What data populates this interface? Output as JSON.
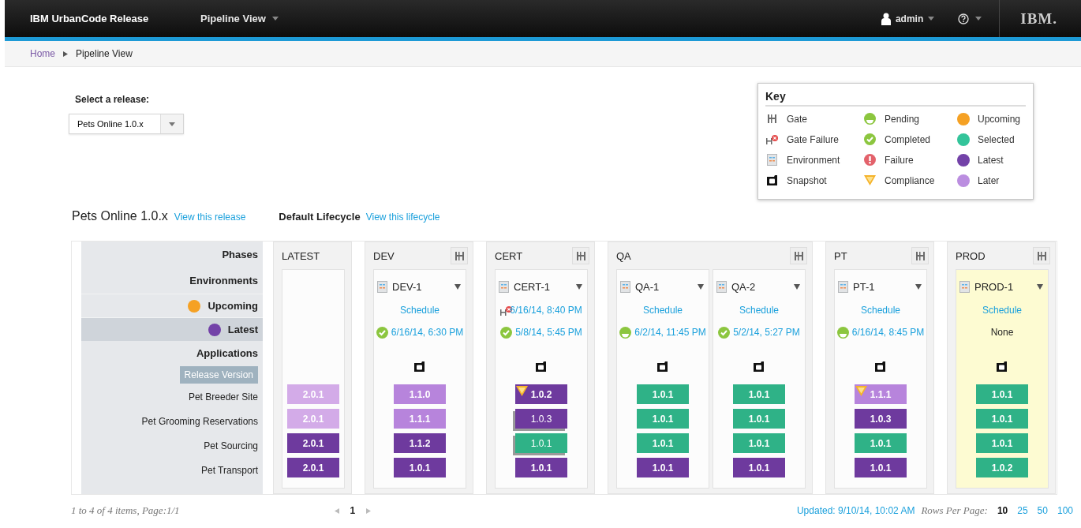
{
  "navbar": {
    "brand": "IBM UrbanCode Release",
    "menu": "Pipeline View",
    "user": "admin",
    "logo": "IBM."
  },
  "breadcrumb": {
    "home": "Home",
    "current": "Pipeline View"
  },
  "release_select": {
    "label": "Select a release:",
    "value": "Pets Online 1.0.x"
  },
  "key": {
    "title": "Key",
    "items": [
      {
        "label": "Gate",
        "kind": "gate"
      },
      {
        "label": "Pending",
        "kind": "pending"
      },
      {
        "label": "Upcoming",
        "kind": "dot",
        "color": "#f5a124"
      },
      {
        "label": "Gate Failure",
        "kind": "gate_failure"
      },
      {
        "label": "Completed",
        "kind": "completed"
      },
      {
        "label": "Selected",
        "kind": "dot",
        "color": "#33c49a"
      },
      {
        "label": "Environment",
        "kind": "environment"
      },
      {
        "label": "Failure",
        "kind": "failure"
      },
      {
        "label": "Latest",
        "kind": "dot",
        "color": "#7342a8"
      },
      {
        "label": "Snapshot",
        "kind": "snapshot"
      },
      {
        "label": "Compliance",
        "kind": "compliance"
      },
      {
        "label": "Later",
        "kind": "dot",
        "color": "#bb8ee0"
      }
    ]
  },
  "heading": {
    "release": "Pets Online 1.0.x",
    "release_link": "View this release",
    "lifecycle": "Default Lifecycle",
    "lifecycle_link": "View this lifecycle"
  },
  "sidebar": {
    "phases": "Phases",
    "environments": "Environments",
    "filters": [
      {
        "label": "Upcoming",
        "color": "#f5a124",
        "selected": false
      },
      {
        "label": "Latest",
        "color": "#7342a8",
        "selected": true
      }
    ],
    "applications": "Applications",
    "release_version": "Release Version",
    "apps": [
      "Pet Breeder Site",
      "Pet Grooming Reservations",
      "Pet Sourcing",
      "Pet Transport"
    ]
  },
  "phases": [
    {
      "name": "LATEST",
      "gate": false,
      "environments": [
        {
          "highlighted": false,
          "versions": [
            {
              "text": "2.0.1",
              "kind": "faded",
              "compliance": false,
              "stacked": false
            },
            {
              "text": "2.0.1",
              "kind": "faded",
              "compliance": false,
              "stacked": false
            },
            {
              "text": "2.0.1",
              "kind": "latest",
              "compliance": false,
              "stacked": false
            },
            {
              "text": "2.0.1",
              "kind": "latest",
              "compliance": false,
              "stacked": false
            }
          ]
        }
      ]
    },
    {
      "name": "DEV",
      "gate": true,
      "environments": [
        {
          "name": "DEV-1",
          "highlighted": false,
          "schedule": {
            "kind": "link",
            "text": "Schedule"
          },
          "last": {
            "kind": "completed",
            "text": "6/16/14, 6:30 PM"
          },
          "versions": [
            {
              "text": "1.1.0",
              "kind": "later",
              "compliance": false,
              "stacked": false
            },
            {
              "text": "1.1.1",
              "kind": "later",
              "compliance": false,
              "stacked": false
            },
            {
              "text": "1.1.2",
              "kind": "latest",
              "compliance": false,
              "stacked": false
            },
            {
              "text": "1.0.1",
              "kind": "latest",
              "compliance": false,
              "stacked": false
            }
          ]
        }
      ]
    },
    {
      "name": "CERT",
      "gate": true,
      "environments": [
        {
          "name": "CERT-1",
          "highlighted": false,
          "schedule": {
            "kind": "gate_failure",
            "text": "6/16/14, 8:40 PM"
          },
          "last": {
            "kind": "completed",
            "text": "5/8/14, 5:45 PM"
          },
          "versions": [
            {
              "text": "1.0.2",
              "kind": "latest",
              "compliance": true,
              "stacked": false
            },
            {
              "text": "1.0.3",
              "kind": "latest",
              "compliance": false,
              "stacked": true
            },
            {
              "text": "1.0.1",
              "kind": "selected",
              "compliance": false,
              "stacked": true
            },
            {
              "text": "1.0.1",
              "kind": "latest",
              "compliance": false,
              "stacked": false
            }
          ]
        }
      ]
    },
    {
      "name": "QA",
      "gate": true,
      "environments": [
        {
          "name": "QA-1",
          "highlighted": false,
          "schedule": {
            "kind": "link",
            "text": "Schedule"
          },
          "last": {
            "kind": "pending",
            "text": "6/2/14, 11:45 PM"
          },
          "versions": [
            {
              "text": "1.0.1",
              "kind": "selected",
              "compliance": false,
              "stacked": false
            },
            {
              "text": "1.0.1",
              "kind": "selected",
              "compliance": false,
              "stacked": false
            },
            {
              "text": "1.0.1",
              "kind": "selected",
              "compliance": false,
              "stacked": false
            },
            {
              "text": "1.0.1",
              "kind": "latest",
              "compliance": false,
              "stacked": false
            }
          ]
        },
        {
          "name": "QA-2",
          "highlighted": false,
          "schedule": {
            "kind": "link",
            "text": "Schedule"
          },
          "last": {
            "kind": "completed",
            "text": "5/2/14, 5:27 PM"
          },
          "versions": [
            {
              "text": "1.0.1",
              "kind": "selected",
              "compliance": false,
              "stacked": false
            },
            {
              "text": "1.0.1",
              "kind": "selected",
              "compliance": false,
              "stacked": false
            },
            {
              "text": "1.0.1",
              "kind": "selected",
              "compliance": false,
              "stacked": false
            },
            {
              "text": "1.0.1",
              "kind": "latest",
              "compliance": false,
              "stacked": false
            }
          ]
        }
      ]
    },
    {
      "name": "PT",
      "gate": true,
      "environments": [
        {
          "name": "PT-1",
          "highlighted": false,
          "schedule": {
            "kind": "link",
            "text": "Schedule"
          },
          "last": {
            "kind": "pending",
            "text": "6/16/14, 8:45 PM"
          },
          "versions": [
            {
              "text": "1.1.1",
              "kind": "later",
              "compliance": true,
              "stacked": false
            },
            {
              "text": "1.0.3",
              "kind": "latest",
              "compliance": false,
              "stacked": false
            },
            {
              "text": "1.0.1",
              "kind": "selected",
              "compliance": false,
              "stacked": false
            },
            {
              "text": "1.0.1",
              "kind": "latest",
              "compliance": false,
              "stacked": false
            }
          ]
        }
      ]
    },
    {
      "name": "PROD",
      "gate": true,
      "environments": [
        {
          "name": "PROD-1",
          "highlighted": true,
          "schedule": {
            "kind": "link",
            "text": "Schedule"
          },
          "last": {
            "kind": "none",
            "text": "None"
          },
          "versions": [
            {
              "text": "1.0.1",
              "kind": "selected",
              "compliance": false,
              "stacked": false
            },
            {
              "text": "1.0.1",
              "kind": "selected",
              "compliance": false,
              "stacked": false
            },
            {
              "text": "1.0.1",
              "kind": "selected",
              "compliance": false,
              "stacked": false
            },
            {
              "text": "1.0.2",
              "kind": "selected",
              "compliance": false,
              "stacked": false
            }
          ]
        }
      ]
    }
  ],
  "footer": {
    "summary": "1 to 4 of 4 items, Page:1/1",
    "page": "1",
    "updated": "Updated: 9/10/14, 10:02 AM",
    "rows_label": "Rows Per Page:",
    "rows_options": [
      {
        "label": "10",
        "selected": true
      },
      {
        "label": "25",
        "selected": false
      },
      {
        "label": "50",
        "selected": false
      },
      {
        "label": "100",
        "selected": false
      }
    ]
  }
}
